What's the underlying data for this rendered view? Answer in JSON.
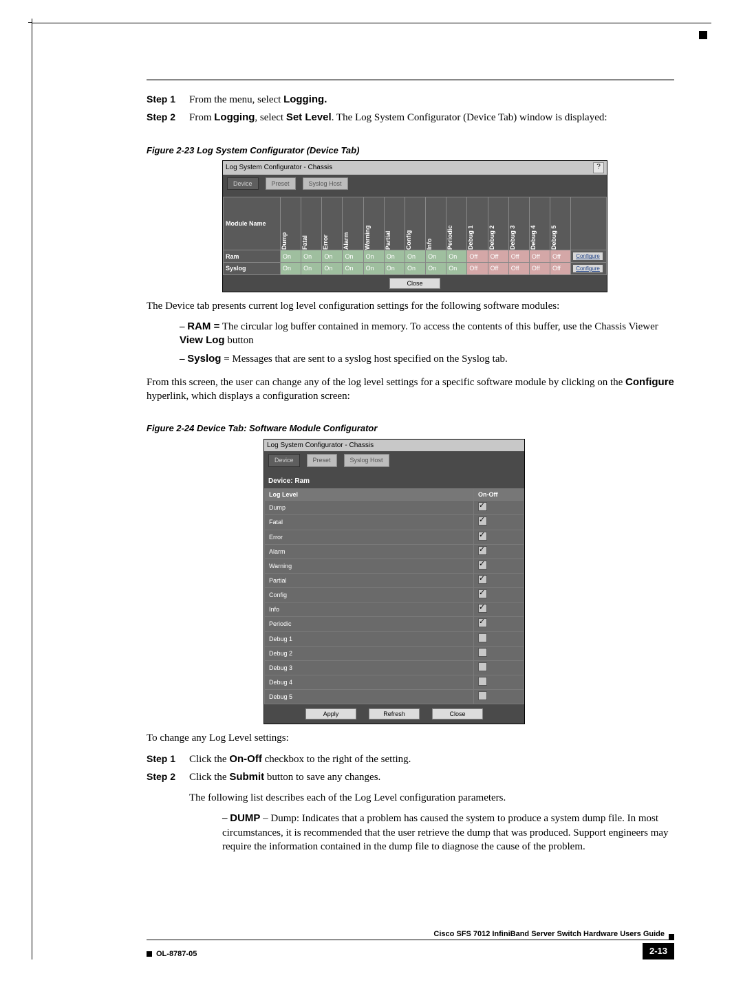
{
  "steps_a": [
    {
      "label": "Step 1",
      "pre": "From the menu, select ",
      "bold": "Logging.",
      "post": ""
    },
    {
      "label": "Step 2",
      "pre": "From ",
      "bold": "Logging",
      "post_mid": ", select ",
      "bold2": "Set Level",
      "post": ". The Log System Configurator (Device Tab) window is displayed:"
    }
  ],
  "fig23": {
    "caption": "Figure 2-23   Log System Configurator (Device Tab)",
    "title": "Log System Configurator - Chassis",
    "help": "?",
    "tabs": [
      "Device",
      "Preset",
      "Syslog Host"
    ],
    "module_col": "Module Name",
    "cols": [
      "Dump",
      "Fatal",
      "Error",
      "Alarm",
      "Warning",
      "Partial",
      "Config",
      "Info",
      "Periodic",
      "Debug 1",
      "Debug 2",
      "Debug 3",
      "Debug 4",
      "Debug 5"
    ],
    "rows": [
      {
        "name": "Ram",
        "vals": [
          "On",
          "On",
          "On",
          "On",
          "On",
          "On",
          "On",
          "On",
          "On",
          "Off",
          "Off",
          "Off",
          "Off",
          "Off"
        ],
        "link": "Configure"
      },
      {
        "name": "Syslog",
        "vals": [
          "On",
          "On",
          "On",
          "On",
          "On",
          "On",
          "On",
          "On",
          "On",
          "Off",
          "Off",
          "Off",
          "Off",
          "Off"
        ],
        "link": "Configure"
      }
    ],
    "close": "Close"
  },
  "para_device_intro": "The Device tab presents current log level configuration settings for the following software modules:",
  "bullets_modules": [
    {
      "bold": "RAM =",
      "rest": " The circular log buffer contained in memory. To access the contents of this buffer, use the Chassis Viewer ",
      "bold2": "View Log",
      "rest2": " button"
    },
    {
      "bold": "Syslog",
      "rest": " = Messages that are sent to a syslog host specified on the Syslog tab."
    }
  ],
  "para_change": {
    "pre": "From this screen, the user can change any of the log level settings for a specific software module by clicking on the ",
    "bold": "Configure",
    "post": " hyperlink, which displays a configuration screen:"
  },
  "fig24": {
    "caption": "Figure 2-24   Device Tab: Software Module Configurator",
    "title": "Log System Configurator - Chassis",
    "tabs": [
      "Device",
      "Preset",
      "Syslog Host"
    ],
    "device_label": "Device: Ram",
    "hdr_level": "Log Level",
    "hdr_onoff": "On-Off",
    "rows": [
      {
        "name": "Dump",
        "on": true
      },
      {
        "name": "Fatal",
        "on": true
      },
      {
        "name": "Error",
        "on": true
      },
      {
        "name": "Alarm",
        "on": true
      },
      {
        "name": "Warning",
        "on": true
      },
      {
        "name": "Partial",
        "on": true
      },
      {
        "name": "Config",
        "on": true
      },
      {
        "name": "Info",
        "on": true
      },
      {
        "name": "Periodic",
        "on": true
      },
      {
        "name": "Debug 1",
        "on": false
      },
      {
        "name": "Debug 2",
        "on": false
      },
      {
        "name": "Debug 3",
        "on": false
      },
      {
        "name": "Debug 4",
        "on": false
      },
      {
        "name": "Debug 5",
        "on": false
      }
    ],
    "buttons": [
      "Apply",
      "Refresh",
      "Close"
    ]
  },
  "para_to_change": "To change any Log Level settings:",
  "steps_b": [
    {
      "label": "Step 1",
      "pre": "Click the ",
      "bold": "On-Off",
      "post": " checkbox to the right of the setting."
    },
    {
      "label": "Step 2",
      "pre": "Click the ",
      "bold": "Submit",
      "post": " button to save any changes."
    }
  ],
  "para_following": "The following list describes each of the Log Level configuration parameters.",
  "bullet_dump": {
    "bold": "DUMP",
    "rest": " – Dump: Indicates that a problem has caused the system to produce a system dump file. In most circumstances, it is recommended that the user retrieve the dump that was produced. Support engineers may require the information contained in the dump file to diagnose the cause of the problem."
  },
  "footer": {
    "doc_title": "Cisco SFS 7012 InfiniBand Server Switch Hardware Users Guide",
    "doc_code": "OL-8787-05",
    "page": "2-13"
  }
}
